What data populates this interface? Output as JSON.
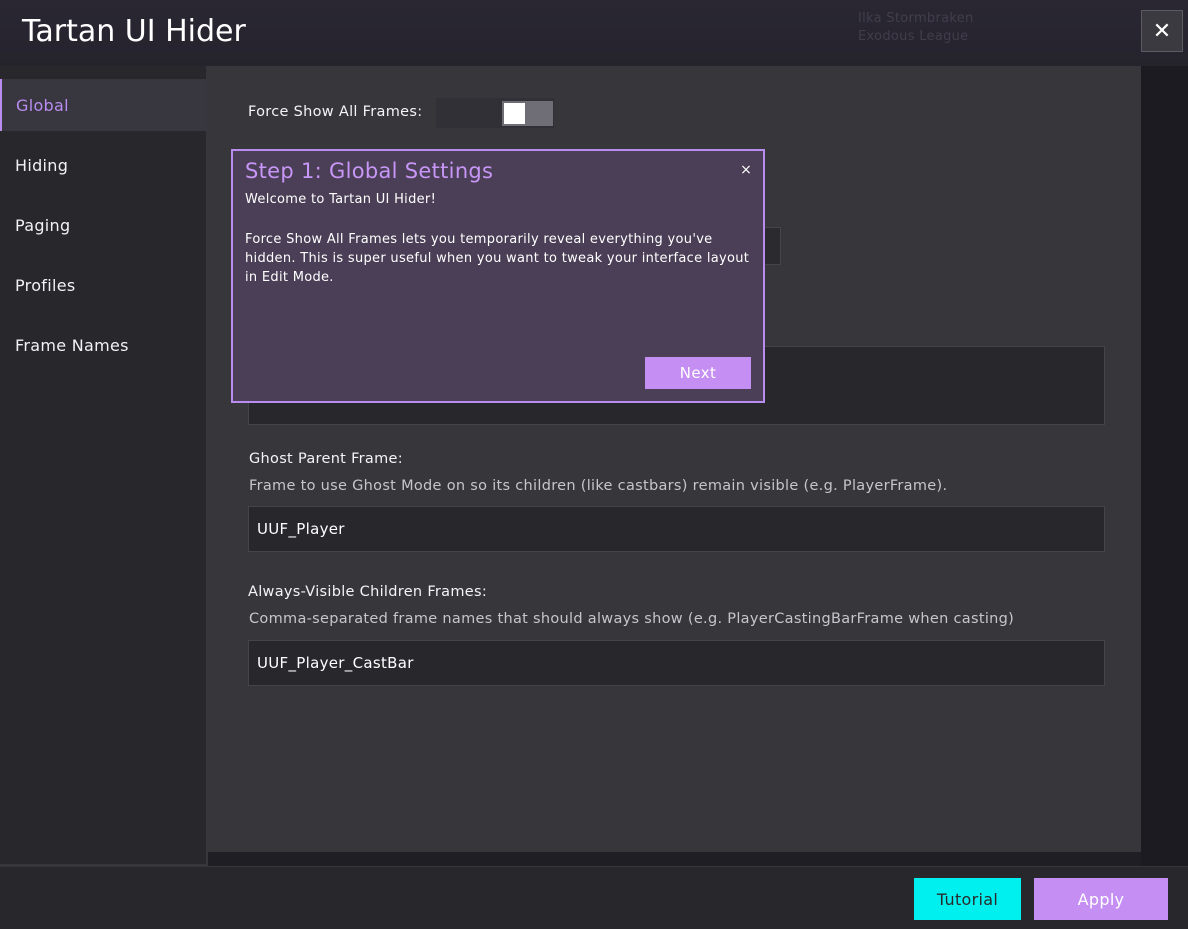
{
  "window": {
    "title": "Tartan UI Hider",
    "close_glyph": "✕",
    "background_text_line1": "Ilka Stormbraken",
    "background_text_line2": "Exodous League"
  },
  "sidebar": {
    "items": [
      {
        "label": "Global",
        "active": true
      },
      {
        "label": "Hiding",
        "active": false
      },
      {
        "label": "Paging",
        "active": false
      },
      {
        "label": "Profiles",
        "active": false
      },
      {
        "label": "Frame Names",
        "active": false
      }
    ]
  },
  "main": {
    "force_show": {
      "label": "Force Show All Frames:",
      "enabled": false
    },
    "ghost_parent": {
      "label": "Ghost Parent Frame:",
      "description": "Frame to use Ghost Mode on so its children (like castbars) remain visible (e.g. PlayerFrame).",
      "value": "UUF_Player"
    },
    "always_visible": {
      "label": "Always-Visible Children Frames:",
      "description": "Comma-separated frame names that should always show (e.g. PlayerCastingBarFrame when casting)",
      "value": "UUF_Player_CastBar"
    }
  },
  "tutorial_popup": {
    "title": "Step 1: Global Settings",
    "close_glyph": "×",
    "welcome": "Welcome to Tartan UI Hider!",
    "body": "Force Show All Frames lets you temporarily reveal everything you've hidden. This is super useful when you want to tweak your interface layout in Edit Mode.",
    "next_label": "Next"
  },
  "footer": {
    "tutorial_label": "Tutorial",
    "apply_label": "Apply"
  },
  "colors": {
    "accent": "#b98cf0",
    "button_purple": "#c48ef2",
    "button_cyan": "#00f0f0",
    "panel": "#37363b",
    "sidebar": "#28272c"
  }
}
